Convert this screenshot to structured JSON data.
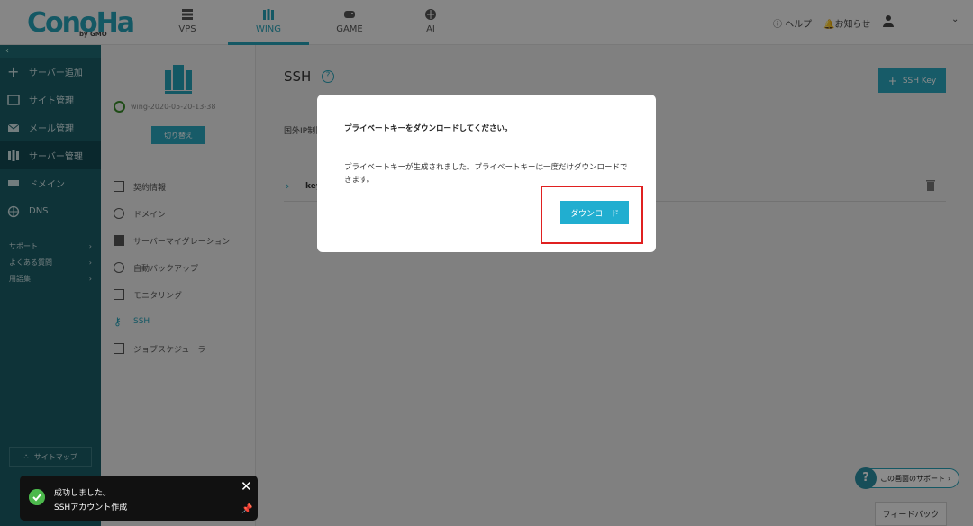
{
  "header": {
    "logo": "ConoHa",
    "logo_sub": "by GMO",
    "tabs": [
      {
        "label": "VPS",
        "active": false
      },
      {
        "label": "WING",
        "active": true
      },
      {
        "label": "GAME",
        "active": false
      },
      {
        "label": "AI",
        "active": false
      }
    ],
    "help": "ヘルプ",
    "notifications": "お知らせ"
  },
  "sidebar": {
    "items": [
      {
        "label": "サーバー追加",
        "icon": "plus-icon"
      },
      {
        "label": "サイト管理",
        "icon": "site-icon"
      },
      {
        "label": "メール管理",
        "icon": "mail-icon"
      },
      {
        "label": "サーバー管理",
        "icon": "server-icon"
      },
      {
        "label": "ドメイン",
        "icon": "domain-icon"
      },
      {
        "label": "DNS",
        "icon": "globe-icon"
      }
    ],
    "small": [
      "サポート",
      "よくある質問",
      "用語集"
    ],
    "sitemap": "サイトマップ"
  },
  "server": {
    "name": "wing-2020-05-20-13-38",
    "switch_label": "切り替え"
  },
  "submenu": [
    {
      "label": "契約情報"
    },
    {
      "label": "ドメイン"
    },
    {
      "label": "サーバーマイグレーション"
    },
    {
      "label": "自動バックアップ"
    },
    {
      "label": "モニタリング"
    },
    {
      "label": "SSH"
    },
    {
      "label": "ジョブスケジューラー"
    }
  ],
  "main": {
    "title": "SSH",
    "add_button": "SSH Key",
    "ip_note": "国外IP制限",
    "key_name": "key"
  },
  "modal": {
    "title": "プライベートキーをダウンロードしてください。",
    "body": "プライベートキーが生成されました。プライベートキーは一度だけダウンロードできます。",
    "download": "ダウンロード"
  },
  "support": "この画面のサポート",
  "feedback": "フィードバック",
  "toast": {
    "line1": "成功しました。",
    "line2": "SSHアカウント作成"
  },
  "colors": {
    "accent": "#26a0b6",
    "sidebar": "#1a5e67",
    "download": "#21aed0",
    "highlight": "#e02020"
  }
}
